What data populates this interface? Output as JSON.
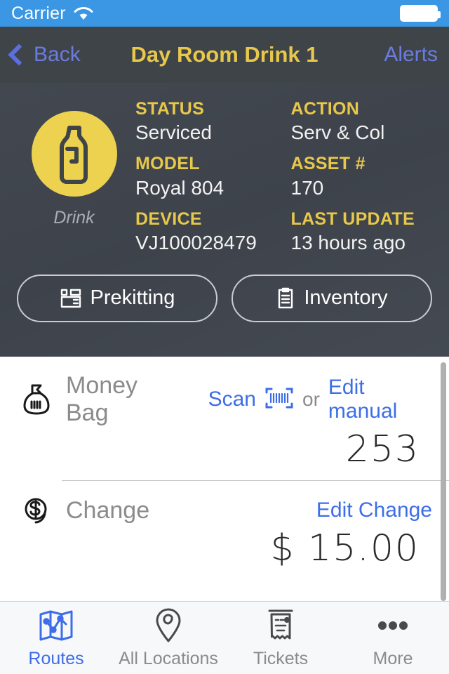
{
  "status_bar": {
    "carrier": "Carrier",
    "wifi_icon": "wifi-icon",
    "battery_icon": "battery-full-icon"
  },
  "nav_bar": {
    "back_label": "Back",
    "back_icon": "chevron-left-icon",
    "title": "Day Room Drink 1",
    "alerts_label": "Alerts",
    "title_color": "#e8c84a",
    "link_color": "#6b7ce0",
    "background": "#3f4449"
  },
  "asset": {
    "icon": "bottle-icon",
    "type_label": "Drink",
    "circle_color": "#ecd24f",
    "fields": [
      {
        "label": "STATUS",
        "value": "Serviced"
      },
      {
        "label": "ACTION",
        "value": "Serv & Col"
      },
      {
        "label": "MODEL",
        "value": "Royal 804"
      },
      {
        "label": "ASSET #",
        "value": "170"
      },
      {
        "label": "DEVICE",
        "value": "VJ100028479"
      },
      {
        "label": "LAST UPDATE",
        "value": "13 hours ago"
      }
    ]
  },
  "actions": {
    "prekitting_label": "Prekitting",
    "prekitting_icon": "package-box-icon",
    "inventory_label": "Inventory",
    "inventory_icon": "clipboard-icon"
  },
  "money_bag": {
    "icon": "money-bag-icon",
    "title": "Money Bag",
    "scan_label": "Scan",
    "scan_icon": "barcode-scan-icon",
    "or_label": "or",
    "edit_label": "Edit manual",
    "value": "253"
  },
  "change": {
    "icon": "dollar-coin-icon",
    "title": "Change",
    "edit_label": "Edit Change",
    "value": "$ 15.00"
  },
  "tab_bar": {
    "accent_color": "#3d6ee8",
    "inactive_color": "#8b8b8b",
    "items": [
      {
        "label": "Routes",
        "icon": "map-route-icon",
        "active": true
      },
      {
        "label": "All Locations",
        "icon": "location-pin-icon",
        "active": false
      },
      {
        "label": "Tickets",
        "icon": "receipt-icon",
        "active": false
      },
      {
        "label": "More",
        "icon": "ellipsis-icon",
        "active": false
      }
    ]
  }
}
